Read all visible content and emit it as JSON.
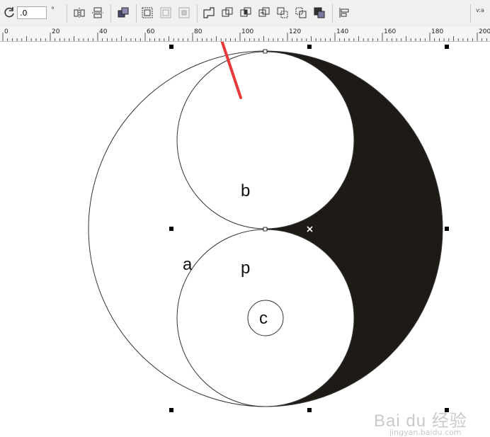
{
  "toolbar": {
    "angle_value": ".0",
    "angle_unit": "°",
    "overflow_text": "v:a"
  },
  "ruler": {
    "ticks": [
      "0",
      "20",
      "40",
      "60",
      "80",
      "100",
      "120",
      "140",
      "160",
      "180",
      "200"
    ]
  },
  "canvas": {
    "labels": {
      "a": "a",
      "b": "b",
      "p": "p",
      "c": "c"
    }
  },
  "watermark": {
    "brand": "Bai du 经验",
    "url": "jingyan.baidu.com"
  },
  "colors": {
    "fill_dark": "#1e1b17",
    "arrow": "#e83a3a",
    "toolbar_bg": "#f0f0f0"
  }
}
